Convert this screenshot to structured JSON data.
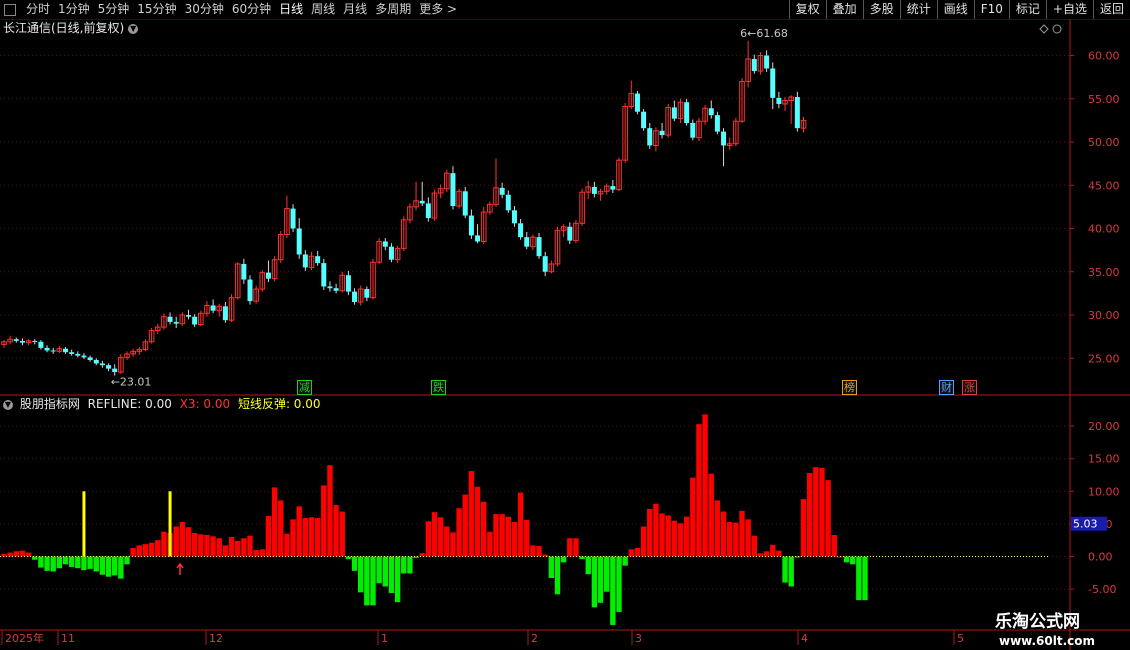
{
  "toolbar": {
    "periods": [
      "分时",
      "1分钟",
      "5分钟",
      "15分钟",
      "30分钟",
      "60分钟",
      "日线",
      "周线",
      "月线",
      "多周期",
      "更多"
    ],
    "active": "日线",
    "buttons": [
      "复权",
      "叠加",
      "多股",
      "统计",
      "画线",
      "F10",
      "标记",
      "+自选",
      "返回"
    ]
  },
  "chart_title": "长江通信(日线,前复权)",
  "indicator": {
    "name": "股朋指标网",
    "refline": "REFLINE: 0.00",
    "x3": "X3: 0.00",
    "rebound": "短线反弹: 0.00",
    "current_value_badge": "5.03"
  },
  "price_axis": {
    "ticks": [
      "60.00",
      "55.00",
      "50.00",
      "45.00",
      "40.00",
      "35.00",
      "30.00",
      "25.00"
    ]
  },
  "ind_axis": {
    "ticks": [
      "20.00",
      "15.00",
      "10.00",
      "5.00",
      "0.00",
      "-5.00"
    ]
  },
  "annotations": {
    "low_price": "23.01",
    "high_price": "61.68"
  },
  "signal_tags": [
    {
      "text": "减",
      "color": "#22cc22"
    },
    {
      "text": "跌",
      "color": "#22cc22"
    },
    {
      "text": "榜",
      "color": "#e0a020"
    },
    {
      "text": "财",
      "color": "#5aa0ff"
    },
    {
      "text": "涨",
      "color": "#e04040"
    }
  ],
  "date_axis": [
    "2025年",
    "11",
    "12",
    "1",
    "2",
    "3",
    "4",
    "5"
  ],
  "logo": {
    "main": "乐淘公式网",
    "url": "www.60lt.com"
  },
  "colors": {
    "up": "#ff3232",
    "down": "#54ffff",
    "bar_up": "#ff0000",
    "bar_down": "#00ee00",
    "signal": "#ffff00",
    "axis": "#b01818"
  },
  "chart_data": [
    {
      "type": "candlestick",
      "title": "长江通信(日线,前复权)",
      "ylim": [
        22,
        63
      ],
      "ohlc": [
        [
          26.6,
          27.1,
          26.2,
          26.9
        ],
        [
          26.9,
          27.6,
          26.6,
          27.2
        ],
        [
          27.2,
          27.4,
          26.8,
          27.0
        ],
        [
          27.0,
          27.3,
          26.5,
          26.8
        ],
        [
          26.8,
          27.2,
          26.5,
          27.0
        ],
        [
          27.0,
          27.2,
          26.6,
          26.9
        ],
        [
          26.9,
          27.1,
          26.0,
          26.2
        ],
        [
          26.2,
          26.5,
          25.7,
          25.9
        ],
        [
          25.9,
          26.2,
          25.5,
          25.8
        ],
        [
          25.8,
          26.4,
          25.6,
          26.1
        ],
        [
          26.1,
          26.3,
          25.5,
          25.7
        ],
        [
          25.7,
          26.0,
          25.3,
          25.5
        ],
        [
          25.5,
          25.8,
          25.1,
          25.3
        ],
        [
          25.3,
          25.6,
          24.9,
          25.1
        ],
        [
          25.1,
          25.3,
          24.6,
          24.8
        ],
        [
          24.8,
          25.0,
          24.2,
          24.4
        ],
        [
          24.4,
          24.7,
          23.9,
          24.2
        ],
        [
          24.2,
          24.4,
          23.5,
          23.8
        ],
        [
          23.8,
          24.3,
          23.0,
          23.4
        ],
        [
          23.4,
          25.5,
          23.2,
          25.1
        ],
        [
          25.1,
          25.8,
          24.8,
          25.5
        ],
        [
          25.5,
          26.1,
          25.2,
          25.8
        ],
        [
          25.8,
          26.3,
          25.4,
          26.0
        ],
        [
          26.0,
          27.2,
          25.8,
          26.9
        ],
        [
          26.9,
          28.5,
          26.7,
          28.2
        ],
        [
          28.2,
          29.0,
          27.8,
          28.6
        ],
        [
          28.6,
          30.2,
          28.3,
          29.8
        ],
        [
          29.8,
          30.3,
          28.9,
          29.2
        ],
        [
          29.2,
          29.8,
          28.5,
          29.0
        ],
        [
          29.0,
          30.3,
          28.7,
          30.0
        ],
        [
          30.0,
          30.6,
          29.5,
          29.8
        ],
        [
          29.8,
          30.1,
          28.6,
          28.9
        ],
        [
          28.9,
          30.5,
          28.7,
          30.2
        ],
        [
          30.2,
          31.6,
          29.8,
          31.1
        ],
        [
          31.1,
          31.8,
          30.2,
          30.5
        ],
        [
          30.5,
          31.3,
          29.8,
          31.0
        ],
        [
          31.0,
          31.5,
          29.1,
          29.4
        ],
        [
          29.4,
          32.4,
          29.2,
          32.0
        ],
        [
          32.0,
          36.1,
          31.8,
          35.9
        ],
        [
          35.9,
          36.5,
          33.6,
          34.1
        ],
        [
          34.1,
          34.6,
          31.2,
          31.6
        ],
        [
          31.6,
          33.4,
          31.3,
          33.0
        ],
        [
          33.0,
          35.2,
          32.7,
          34.9
        ],
        [
          34.9,
          36.3,
          33.8,
          34.2
        ],
        [
          34.2,
          36.8,
          33.9,
          36.4
        ],
        [
          36.4,
          39.7,
          36.0,
          39.3
        ],
        [
          39.3,
          43.8,
          38.9,
          42.3
        ],
        [
          42.3,
          42.8,
          39.6,
          40.0
        ],
        [
          40.0,
          41.2,
          36.5,
          37.0
        ],
        [
          37.0,
          37.5,
          35.1,
          35.5
        ],
        [
          35.5,
          37.3,
          35.2,
          36.8
        ],
        [
          36.8,
          37.4,
          35.7,
          36.0
        ],
        [
          36.0,
          36.5,
          32.9,
          33.3
        ],
        [
          33.3,
          33.9,
          32.7,
          33.1
        ],
        [
          33.1,
          33.6,
          32.5,
          32.8
        ],
        [
          32.8,
          35.0,
          32.6,
          34.6
        ],
        [
          34.6,
          35.1,
          32.3,
          32.7
        ],
        [
          32.7,
          33.1,
          31.2,
          31.5
        ],
        [
          31.5,
          33.4,
          31.1,
          33.0
        ],
        [
          33.0,
          33.3,
          31.6,
          32.0
        ],
        [
          32.0,
          36.5,
          31.8,
          36.1
        ],
        [
          36.1,
          38.9,
          35.9,
          38.5
        ],
        [
          38.5,
          38.9,
          37.5,
          37.9
        ],
        [
          37.9,
          38.3,
          36.1,
          36.4
        ],
        [
          36.4,
          38.0,
          36.0,
          37.7
        ],
        [
          37.7,
          41.4,
          37.4,
          41.0
        ],
        [
          41.0,
          42.9,
          40.6,
          42.5
        ],
        [
          42.5,
          45.4,
          42.1,
          43.2
        ],
        [
          43.2,
          45.4,
          42.6,
          42.9
        ],
        [
          42.9,
          43.6,
          40.8,
          41.2
        ],
        [
          41.2,
          44.5,
          40.9,
          44.1
        ],
        [
          44.1,
          45.1,
          43.5,
          44.6
        ],
        [
          44.6,
          46.8,
          44.2,
          46.4
        ],
        [
          46.4,
          47.2,
          42.2,
          42.6
        ],
        [
          42.6,
          44.6,
          42.3,
          44.3
        ],
        [
          44.3,
          44.8,
          41.2,
          41.5
        ],
        [
          41.5,
          42.2,
          38.8,
          39.2
        ],
        [
          39.2,
          40.5,
          38.3,
          38.5
        ],
        [
          38.5,
          42.5,
          38.2,
          41.9
        ],
        [
          41.9,
          43.1,
          41.6,
          42.8
        ],
        [
          42.8,
          48.1,
          42.5,
          44.7
        ],
        [
          44.7,
          45.3,
          43.5,
          43.9
        ],
        [
          43.9,
          44.4,
          41.8,
          42.1
        ],
        [
          42.1,
          42.6,
          40.2,
          40.6
        ],
        [
          40.6,
          41.1,
          38.7,
          39.0
        ],
        [
          39.0,
          39.6,
          37.6,
          37.9
        ],
        [
          37.9,
          39.3,
          37.5,
          39.0
        ],
        [
          39.0,
          39.5,
          36.5,
          36.8
        ],
        [
          36.8,
          37.3,
          34.5,
          35.0
        ],
        [
          35.0,
          36.3,
          34.8,
          35.9
        ],
        [
          35.9,
          40.2,
          35.6,
          39.8
        ],
        [
          39.8,
          40.5,
          39.0,
          40.2
        ],
        [
          40.2,
          40.7,
          38.2,
          38.6
        ],
        [
          38.6,
          41.0,
          38.3,
          40.6
        ],
        [
          40.6,
          44.6,
          40.3,
          44.2
        ],
        [
          44.2,
          45.5,
          43.4,
          44.8
        ],
        [
          44.8,
          45.4,
          43.6,
          44.0
        ],
        [
          44.0,
          44.6,
          43.2,
          44.3
        ],
        [
          44.3,
          45.2,
          43.9,
          44.9
        ],
        [
          44.9,
          45.6,
          44.1,
          44.5
        ],
        [
          44.5,
          48.2,
          44.3,
          47.9
        ],
        [
          47.9,
          54.5,
          47.6,
          54.1
        ],
        [
          54.1,
          57.1,
          53.8,
          55.6
        ],
        [
          55.6,
          55.9,
          53.2,
          53.5
        ],
        [
          53.5,
          53.8,
          51.3,
          51.6
        ],
        [
          51.6,
          52.2,
          49.2,
          49.6
        ],
        [
          49.6,
          51.7,
          48.9,
          51.3
        ],
        [
          51.3,
          52.2,
          50.4,
          50.8
        ],
        [
          50.8,
          54.4,
          50.5,
          54.0
        ],
        [
          54.0,
          54.8,
          52.4,
          52.7
        ],
        [
          52.7,
          55.0,
          52.2,
          54.6
        ],
        [
          54.6,
          55.0,
          51.9,
          52.2
        ],
        [
          52.2,
          52.6,
          50.2,
          50.5
        ],
        [
          50.5,
          52.8,
          50.1,
          52.4
        ],
        [
          52.4,
          54.3,
          52.0,
          53.9
        ],
        [
          53.9,
          54.8,
          52.7,
          53.1
        ],
        [
          53.1,
          53.5,
          50.9,
          51.2
        ],
        [
          51.2,
          51.6,
          47.2,
          49.6
        ],
        [
          49.6,
          50.5,
          49.1,
          49.8
        ],
        [
          49.8,
          52.8,
          49.5,
          52.4
        ],
        [
          52.4,
          57.4,
          52.2,
          57.0
        ],
        [
          57.0,
          61.7,
          56.3,
          59.6
        ],
        [
          59.6,
          60.1,
          57.9,
          58.2
        ],
        [
          58.2,
          60.4,
          57.8,
          60.0
        ],
        [
          60.0,
          60.6,
          58.1,
          58.5
        ],
        [
          58.5,
          59.2,
          53.8,
          55.1
        ],
        [
          55.1,
          55.8,
          53.9,
          54.4
        ],
        [
          54.4,
          55.2,
          53.6,
          54.8
        ],
        [
          54.8,
          55.4,
          52.1,
          55.2
        ],
        [
          55.2,
          55.8,
          51.2,
          51.6
        ],
        [
          51.6,
          52.9,
          51.1,
          52.5
        ]
      ]
    },
    {
      "type": "bar",
      "title": "股朋指标网",
      "ylim": [
        -10.5,
        22.5
      ],
      "values": [
        0.4,
        0.6,
        0.8,
        0.9,
        0.6,
        -0.5,
        -1.7,
        -2.2,
        -2.3,
        -1.8,
        -1.2,
        -1.6,
        -1.8,
        -2.1,
        -1.9,
        -2.3,
        -2.8,
        -3.1,
        -2.9,
        -3.4,
        -1.2,
        1.3,
        1.7,
        1.9,
        2.1,
        2.5,
        3.8,
        3.6,
        4.6,
        5.3,
        4.5,
        3.6,
        3.4,
        3.3,
        3.1,
        2.8,
        1.7,
        3.0,
        2.4,
        2.8,
        3.2,
        1.0,
        1.1,
        6.2,
        10.6,
        8.6,
        3.5,
        5.7,
        7.7,
        5.9,
        6.0,
        5.9,
        10.9,
        14.0,
        7.9,
        6.9,
        -0.4,
        -2.2,
        -5.5,
        -7.5,
        -7.5,
        -4.1,
        -4.6,
        -5.6,
        -7.0,
        -2.6,
        -2.6,
        -0.2,
        0.5,
        5.4,
        6.8,
        6.0,
        4.6,
        3.7,
        7.4,
        9.5,
        13.1,
        10.7,
        8.4,
        3.8,
        6.5,
        6.5,
        6.1,
        5.3,
        9.8,
        5.6,
        1.7,
        1.6,
        0.3,
        -3.3,
        -5.8,
        -0.9,
        2.8,
        2.8,
        -0.4,
        -2.7,
        -7.8,
        -7.1,
        -5.4,
        -10.5,
        -8.5,
        -1.4,
        1.1,
        1.3,
        4.6,
        7.3,
        8.1,
        6.6,
        6.3,
        5.5,
        5.1,
        6.1,
        12.1,
        20.3,
        21.8,
        12.7,
        8.6,
        6.9,
        5.3,
        5.2,
        7.0,
        5.7,
        3.2,
        0.5,
        0.8,
        1.8,
        0.9,
        -4.0,
        -4.6,
        -0.1,
        8.8,
        12.8,
        13.7,
        13.6,
        11.7,
        3.3,
        0.0,
        -0.9,
        -1.2,
        -6.7,
        -6.7
      ],
      "signal_bars": [
        {
          "index": 13,
          "value": 10.0
        },
        {
          "index": 27,
          "value": 10.0
        }
      ]
    }
  ]
}
